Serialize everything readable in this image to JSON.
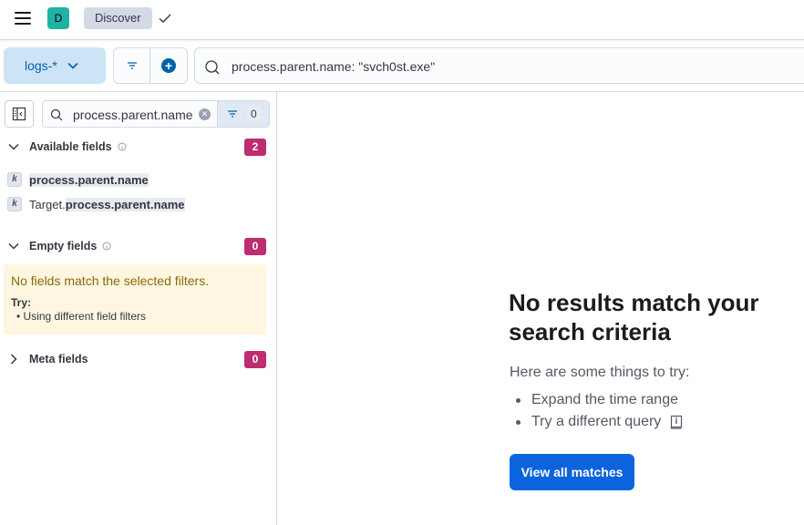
{
  "header": {
    "avatar_initial": "D",
    "breadcrumb": "Discover"
  },
  "query": {
    "data_view": "logs-*",
    "text": "process.parent.name: \"svch0st.exe\""
  },
  "sidebar": {
    "search_value": "process.parent.name",
    "filter_count": "0",
    "available": {
      "title": "Available fields",
      "count": "2",
      "fields": [
        {
          "prefix": "",
          "match": "process.parent.name",
          "type": "k"
        },
        {
          "prefix": "Target.",
          "match": "process.parent.name",
          "type": "k"
        }
      ]
    },
    "empty": {
      "title": "Empty fields",
      "count": "0",
      "callout_title": "No fields match the selected filters.",
      "try_label": "Try:",
      "tip": "Using different field filters"
    },
    "meta": {
      "title": "Meta fields",
      "count": "0"
    }
  },
  "main": {
    "title": "No results match your search criteria",
    "subtitle": "Here are some things to try:",
    "suggestions": [
      "Expand the time range",
      "Try a different query"
    ],
    "button_label": "View all matches"
  },
  "colors": {
    "accent": "#0b64dd",
    "badge": "#bd2d6f",
    "callout_bg": "#fef6e0"
  }
}
